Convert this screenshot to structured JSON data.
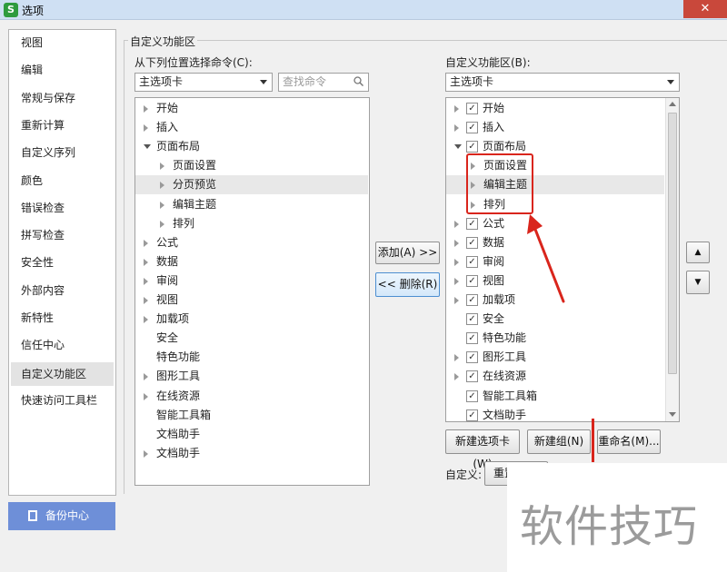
{
  "window": {
    "title": "选项",
    "app_icon": "S",
    "close_glyph": "✕"
  },
  "nav": {
    "items": [
      "视图",
      "编辑",
      "常规与保存",
      "重新计算",
      "自定义序列",
      "颜色",
      "错误检查",
      "拼写检查",
      "安全性",
      "外部内容",
      "新特性",
      "信任中心",
      "自定义功能区",
      "快速访问工具栏"
    ],
    "active_index": 12,
    "backup_label": "备份中心"
  },
  "group_title": "自定义功能区",
  "left_panel": {
    "label": "从下列位置选择命令(C):",
    "dropdown_value": "主选项卡",
    "search_placeholder": "查找命令",
    "tree": [
      {
        "label": "开始",
        "level": 0,
        "toggle": "collapsed"
      },
      {
        "label": "插入",
        "level": 0,
        "toggle": "collapsed"
      },
      {
        "label": "页面布局",
        "level": 0,
        "toggle": "expanded"
      },
      {
        "label": "页面设置",
        "level": 1,
        "toggle": "collapsed"
      },
      {
        "label": "分页预览",
        "level": 1,
        "toggle": "collapsed",
        "selected": true
      },
      {
        "label": "编辑主题",
        "level": 1,
        "toggle": "collapsed"
      },
      {
        "label": "排列",
        "level": 1,
        "toggle": "collapsed"
      },
      {
        "label": "公式",
        "level": 0,
        "toggle": "collapsed"
      },
      {
        "label": "数据",
        "level": 0,
        "toggle": "collapsed"
      },
      {
        "label": "审阅",
        "level": 0,
        "toggle": "collapsed"
      },
      {
        "label": "视图",
        "level": 0,
        "toggle": "collapsed"
      },
      {
        "label": "加载项",
        "level": 0,
        "toggle": "collapsed"
      },
      {
        "label": "安全",
        "level": 0,
        "toggle": "none"
      },
      {
        "label": "特色功能",
        "level": 0,
        "toggle": "none"
      },
      {
        "label": "图形工具",
        "level": 0,
        "toggle": "collapsed"
      },
      {
        "label": "在线资源",
        "level": 0,
        "toggle": "collapsed"
      },
      {
        "label": "智能工具箱",
        "level": 0,
        "toggle": "none"
      },
      {
        "label": "文档助手",
        "level": 0,
        "toggle": "none"
      },
      {
        "label": "文档助手",
        "level": 0,
        "toggle": "collapsed"
      }
    ]
  },
  "middle_buttons": {
    "add": "添加(A) >>",
    "remove": "<< 删除(R)"
  },
  "right_panel": {
    "label": "自定义功能区(B):",
    "dropdown_value": "主选项卡",
    "tree": [
      {
        "label": "开始",
        "level": 0,
        "toggle": "collapsed",
        "checked": true
      },
      {
        "label": "插入",
        "level": 0,
        "toggle": "collapsed",
        "checked": true
      },
      {
        "label": "页面布局",
        "level": 0,
        "toggle": "expanded",
        "checked": true
      },
      {
        "label": "页面设置",
        "level": 1,
        "toggle": "collapsed"
      },
      {
        "label": "编辑主题",
        "level": 1,
        "toggle": "collapsed",
        "selected": true
      },
      {
        "label": "排列",
        "level": 1,
        "toggle": "collapsed"
      },
      {
        "label": "公式",
        "level": 0,
        "toggle": "collapsed",
        "checked": true
      },
      {
        "label": "数据",
        "level": 0,
        "toggle": "collapsed",
        "checked": true
      },
      {
        "label": "审阅",
        "level": 0,
        "toggle": "collapsed",
        "checked": true
      },
      {
        "label": "视图",
        "level": 0,
        "toggle": "collapsed",
        "checked": true
      },
      {
        "label": "加载项",
        "level": 0,
        "toggle": "collapsed",
        "checked": true
      },
      {
        "label": "安全",
        "level": 0,
        "toggle": "none",
        "checked": true
      },
      {
        "label": "特色功能",
        "level": 0,
        "toggle": "none",
        "checked": true
      },
      {
        "label": "图形工具",
        "level": 0,
        "toggle": "collapsed",
        "checked": true
      },
      {
        "label": "在线资源",
        "level": 0,
        "toggle": "collapsed",
        "checked": true
      },
      {
        "label": "智能工具箱",
        "level": 0,
        "toggle": "none",
        "checked": true
      },
      {
        "label": "文档助手",
        "level": 0,
        "toggle": "none",
        "checked": true
      }
    ],
    "buttons": {
      "new_tab": "新建选项卡(W)",
      "new_group": "新建组(N)",
      "rename": "重命名(M)..."
    },
    "customize_label": "自定义:",
    "reset_label": "重置"
  },
  "updown": {
    "up": "▲",
    "down": "▼"
  },
  "watermark": "软件技巧",
  "colors": {
    "annotation": "#d9251c",
    "backup_button": "#6e8fd8"
  }
}
